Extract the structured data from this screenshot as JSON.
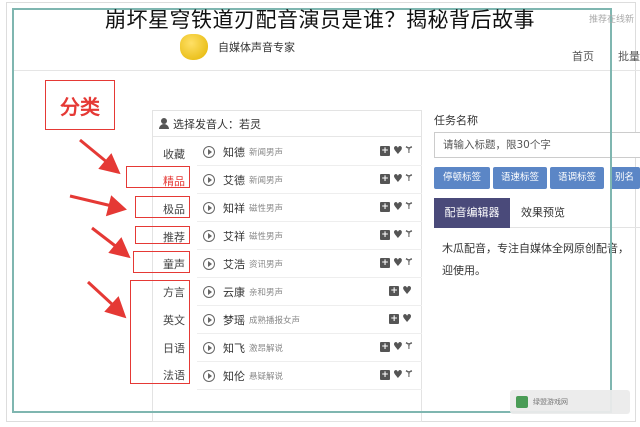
{
  "overlay_title": "崩坏星穹铁道刃配音演员是谁？揭秘背后故事",
  "watermark_top": "推荐在线新",
  "watermark_bottom": "绿盟游戏网",
  "header": {
    "brand_name": "自媒体声音专家",
    "nav_home": "首页",
    "nav_batch": "批量"
  },
  "annotation": {
    "title": "分类"
  },
  "voice_panel": {
    "header_label": "选择发音人：若灵",
    "categories": [
      {
        "label": "收藏"
      },
      {
        "label": "精品"
      },
      {
        "label": "极品"
      },
      {
        "label": "推荐"
      },
      {
        "label": "童声"
      },
      {
        "label": "方言"
      },
      {
        "label": "英文"
      },
      {
        "label": "日语"
      },
      {
        "label": "法语"
      }
    ],
    "voices": [
      {
        "name": "知德",
        "desc": "新闻男声",
        "fork": true
      },
      {
        "name": "艾德",
        "desc": "新闻男声",
        "fork": true
      },
      {
        "name": "知祥",
        "desc": "磁性男声",
        "fork": true
      },
      {
        "name": "艾祥",
        "desc": "磁性男声",
        "fork": true
      },
      {
        "name": "艾浩",
        "desc": "资讯男声",
        "fork": true
      },
      {
        "name": "云康",
        "desc": "亲和男声",
        "fork": false
      },
      {
        "name": "梦瑶",
        "desc": "成熟播报女声",
        "fork": false
      },
      {
        "name": "知飞",
        "desc": "激昂解说",
        "fork": true
      },
      {
        "name": "知伦",
        "desc": "悬疑解说",
        "fork": true
      }
    ]
  },
  "task": {
    "label": "任务名称",
    "input_placeholder": "请输入标题，限30个字"
  },
  "tags": {
    "pause": "停顿标签",
    "speed": "语速标签",
    "tone": "语调标签",
    "alias": "别名"
  },
  "editor": {
    "tab_edit": "配音编辑器",
    "tab_preview": "效果预览",
    "line1": "木瓜配音，专注自媒体全网原创配音，",
    "line2": "迎使用。"
  },
  "colors": {
    "annotation_red": "#e53935",
    "tag_blue": "#5b86c6",
    "tab_active": "#4a4a7a",
    "frame_teal": "#7fb6b0"
  }
}
